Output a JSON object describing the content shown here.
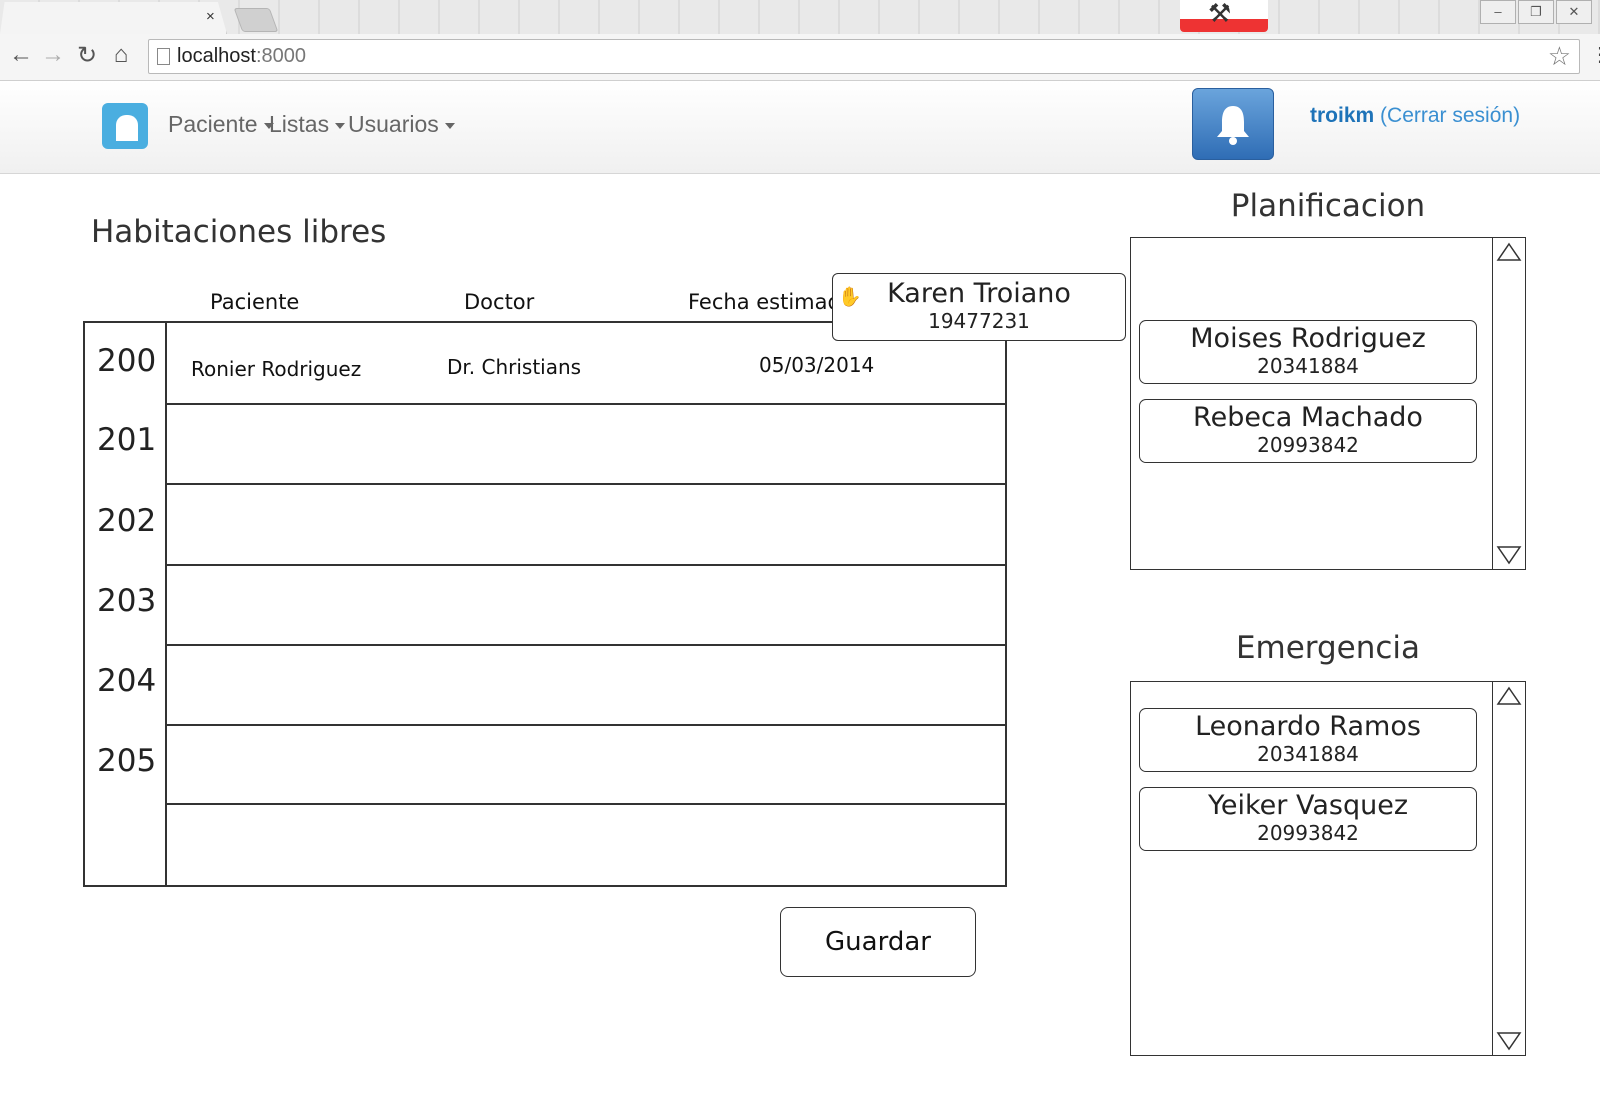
{
  "browser": {
    "tab_close": "×",
    "url_host": "localhost",
    "url_port": ":8000",
    "window_controls": [
      "–",
      "❐",
      "✕"
    ]
  },
  "navbar": {
    "menu": [
      "Paciente",
      "Listas",
      "Usuarios"
    ],
    "username": "troikm",
    "logout": "(Cerrar sesión)"
  },
  "main": {
    "title": "Habitaciones libres",
    "columns": [
      "Paciente",
      "Doctor",
      "Fecha estimad"
    ],
    "rooms": [
      "200",
      "201",
      "202",
      "203",
      "204",
      "205"
    ],
    "assignment": {
      "paciente": "Ronier Rodriguez",
      "doctor": "Dr. Christians",
      "fecha": "05/03/2014"
    },
    "dragging": {
      "name": "Karen Troiano",
      "id": "19477231"
    },
    "save_label": "Guardar"
  },
  "planificacion": {
    "title": "Planificacion",
    "patients": [
      {
        "name": "Moises Rodriguez",
        "id": "20341884"
      },
      {
        "name": "Rebeca Machado",
        "id": "20993842"
      }
    ]
  },
  "emergencia": {
    "title": "Emergencia",
    "patients": [
      {
        "name": "Leonardo Ramos",
        "id": "20341884"
      },
      {
        "name": "Yeiker Vasquez",
        "id": "20993842"
      }
    ]
  },
  "colors": {
    "link": "#3a8fd1",
    "accent": "#4aaee0",
    "bell": "#2f6db5"
  },
  "icons": [
    "back-icon",
    "forward-icon",
    "reload-icon",
    "home-icon",
    "page-icon",
    "star-icon",
    "menu-icon",
    "bell-icon",
    "grab-hand-icon",
    "scroll-up-icon",
    "scroll-down-icon"
  ]
}
